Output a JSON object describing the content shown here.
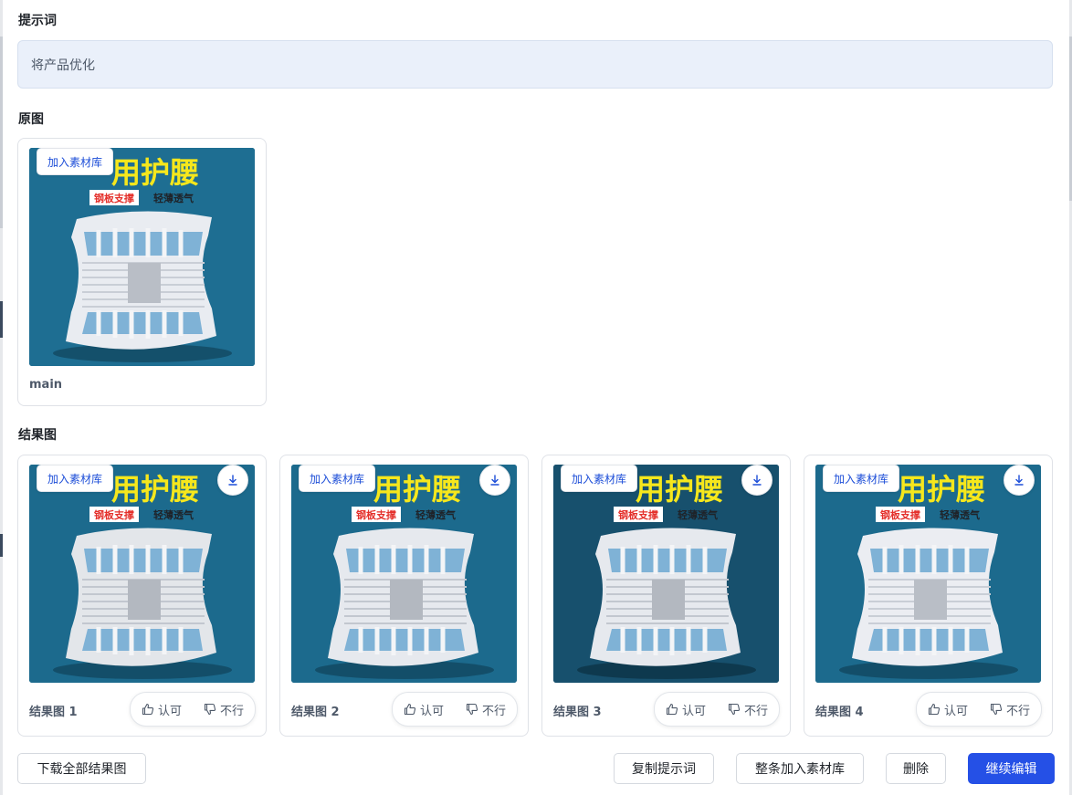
{
  "prompt": {
    "title": "提示词",
    "text": "将产品优化"
  },
  "original": {
    "title": "原图",
    "add_to_library_label": "加入素材库",
    "image_label": "main",
    "image": {
      "headline": "用护腰",
      "tag_red": "钢板支撑",
      "tag_plain": "轻薄透气"
    }
  },
  "results": {
    "title": "结果图",
    "items": [
      {
        "label": "结果图 1",
        "add_to_library_label": "加入素材库",
        "approve_label": "认可",
        "reject_label": "不行",
        "image": {
          "headline": "用护腰",
          "tag_red": "钢板支撑",
          "tag_plain": "轻薄透气"
        }
      },
      {
        "label": "结果图 2",
        "add_to_library_label": "加入素材库",
        "approve_label": "认可",
        "reject_label": "不行",
        "image": {
          "headline": "用护腰",
          "tag_red": "钢板支撑",
          "tag_plain": "轻薄透气"
        }
      },
      {
        "label": "结果图 3",
        "add_to_library_label": "加入素材库",
        "approve_label": "认可",
        "reject_label": "不行",
        "image": {
          "headline": "用护腰",
          "tag_red": "钢板支撑",
          "tag_plain": "轻薄透气"
        }
      },
      {
        "label": "结果图 4",
        "add_to_library_label": "加入素材库",
        "approve_label": "认可",
        "reject_label": "不行",
        "image": {
          "headline": "用护腰",
          "tag_red": "钢板支撑",
          "tag_plain": "轻薄透气"
        }
      }
    ]
  },
  "footer": {
    "download_all_label": "下载全部结果图",
    "copy_prompt_label": "复制提示词",
    "add_all_label": "整条加入素材库",
    "delete_label": "删除",
    "continue_label": "继续编辑"
  },
  "colors": {
    "primary": "#2550e6",
    "link_blue": "#1d4ed8",
    "prompt_bg": "#eaf0fa",
    "product_bg": "#1c6a8d",
    "headline_yellow": "#f6e71c",
    "tag_red": "#e4302b"
  },
  "icons": {
    "download": "download-icon",
    "approve": "thumbs-up-icon",
    "reject": "thumbs-down-icon"
  }
}
